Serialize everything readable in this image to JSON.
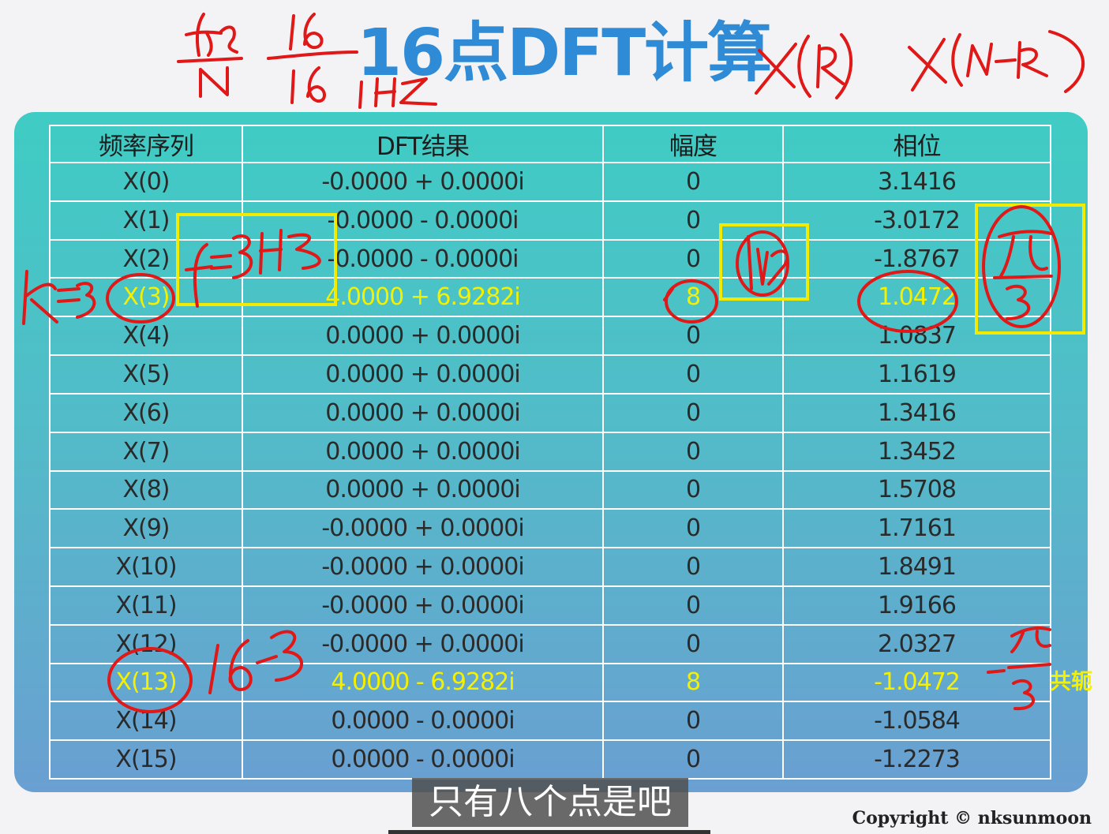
{
  "title": "16点DFT计算",
  "table": {
    "headers": [
      "频率序列",
      "DFT结果",
      "幅度",
      "相位"
    ],
    "rows": [
      {
        "freq": "X(0)",
        "dft": "-0.0000 + 0.0000i",
        "magnitude": "0",
        "phase": "3.1416"
      },
      {
        "freq": "X(1)",
        "dft": "-0.0000 - 0.0000i",
        "magnitude": "0",
        "phase": "-3.0172"
      },
      {
        "freq": "X(2)",
        "dft": "-0.0000 - 0.0000i",
        "magnitude": "0",
        "phase": "-1.8767"
      },
      {
        "freq": "X(3)",
        "dft": "4.0000 + 6.9282i",
        "magnitude": "8",
        "phase": "1.0472",
        "highlight": true
      },
      {
        "freq": "X(4)",
        "dft": "0.0000 + 0.0000i",
        "magnitude": "0",
        "phase": "1.0837"
      },
      {
        "freq": "X(5)",
        "dft": "0.0000 + 0.0000i",
        "magnitude": "0",
        "phase": "1.1619"
      },
      {
        "freq": "X(6)",
        "dft": "0.0000 + 0.0000i",
        "magnitude": "0",
        "phase": "1.3416"
      },
      {
        "freq": "X(7)",
        "dft": "0.0000 + 0.0000i",
        "magnitude": "0",
        "phase": "1.3452"
      },
      {
        "freq": "X(8)",
        "dft": "0.0000 + 0.0000i",
        "magnitude": "0",
        "phase": "1.5708"
      },
      {
        "freq": "X(9)",
        "dft": "-0.0000 + 0.0000i",
        "magnitude": "0",
        "phase": "1.7161"
      },
      {
        "freq": "X(10)",
        "dft": "-0.0000 + 0.0000i",
        "magnitude": "0",
        "phase": "1.8491"
      },
      {
        "freq": "X(11)",
        "dft": "-0.0000 + 0.0000i",
        "magnitude": "0",
        "phase": "1.9166"
      },
      {
        "freq": "X(12)",
        "dft": "-0.0000 + 0.0000i",
        "magnitude": "0",
        "phase": "2.0327"
      },
      {
        "freq": "X(13)",
        "dft": "4.0000 - 6.9282i",
        "magnitude": "8",
        "phase": "-1.0472",
        "highlight": true
      },
      {
        "freq": "X(14)",
        "dft": "0.0000 - 0.0000i",
        "magnitude": "0",
        "phase": "-1.0584"
      },
      {
        "freq": "X(15)",
        "dft": "0.0000 - 0.0000i",
        "magnitude": "0",
        "phase": "-1.2273"
      }
    ]
  },
  "annotations": {
    "conjugate_label": "共轭",
    "handwritten": {
      "fs_over_n": "fs/N",
      "sixteen_over_sixteen": "16/16",
      "one_hz": "1HZ",
      "x_k": "X(k)",
      "x_n_minus_k": "X(N-k)",
      "k_equals_3": "k=3",
      "f_equals_3hz": "f=3HZ",
      "n_over_2": "N/2",
      "pi_over_3": "π/3",
      "minus_pi_over_3": "-π/3",
      "sixteen_minus_three": "16-3"
    },
    "colors": {
      "ink": "#e01818",
      "highlight_box": "#f2ea00",
      "highlight_text": "#f5f000",
      "title": "#2f8bd6"
    }
  },
  "subtitle": "只有八个点是吧",
  "copyright": "Copyright © nksunmoon"
}
